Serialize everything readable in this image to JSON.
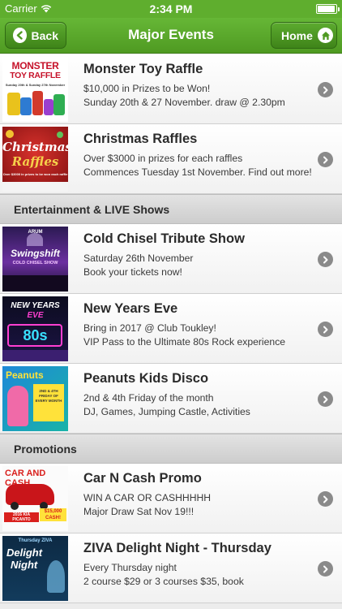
{
  "status_bar": {
    "carrier": "Carrier",
    "time": "2:34 PM",
    "battery_level": 0.95
  },
  "nav": {
    "back_label": "Back",
    "title": "Major Events",
    "home_label": "Home"
  },
  "sections": [
    {
      "header": "",
      "items": [
        {
          "title": "Monster Toy Raffle",
          "line1": "$10,000 in Prizes to be Won!",
          "line2": "Sunday 20th & 27 November. draw @ 2.30pm",
          "thumb_text": [
            "MONSTER",
            "TOY RAFFLE",
            "Sunday 20th & Sunday 27th November"
          ]
        },
        {
          "title": "Christmas Raffles",
          "line1": "Over $3000 in prizes for each raffles",
          "line2": "Commences Tuesday 1st November. Find out more!",
          "thumb_text": [
            "Christmas",
            "Raffles",
            "Over $3000 in prizes to be won each raffle"
          ]
        }
      ]
    },
    {
      "header": "Entertainment & LIVE Shows",
      "items": [
        {
          "title": "Cold Chisel Tribute Show",
          "line1": "Saturday 26th November",
          "line2": "Book your tickets now!",
          "thumb_text": [
            "ARUM",
            "Swingshift",
            "COLD CHISEL SHOW"
          ]
        },
        {
          "title": "New Years Eve",
          "line1": "Bring in 2017 @ Club Toukley!",
          "line2": "VIP Pass to the Ultimate 80s Rock experience",
          "thumb_text": [
            "NEW YEARS",
            "EVE",
            "80s"
          ]
        },
        {
          "title": "Peanuts Kids Disco",
          "line1": "2nd & 4th Friday of the month",
          "line2": "DJ, Games, Jumping Castle, Activities",
          "thumb_text": [
            "Peanuts",
            "2ND & 4TH FRIDAY OF EVERY MONTH"
          ]
        }
      ]
    },
    {
      "header": "Promotions",
      "items": [
        {
          "title": "Car N Cash Promo",
          "line1": "WIN A CAR OR CASHHHHH",
          "line2": "Major Draw Sat Nov 19!!!",
          "thumb_text": [
            "CAR AND CASH",
            "2016 KIA PICANTO",
            "$15,000 CASH!"
          ]
        },
        {
          "title": "ZIVA Delight Night - Thursday",
          "line1": "Every Thursday night",
          "line2": "2 course $29 or 3 courses $35, book",
          "thumb_text": [
            "Thursday ZIVA",
            "Delight",
            "Night"
          ]
        }
      ]
    }
  ],
  "colors": {
    "nav_green": "#5fae2e",
    "chevron_grey": "#8a8a8a",
    "section_bg": "#d6d6d6"
  }
}
